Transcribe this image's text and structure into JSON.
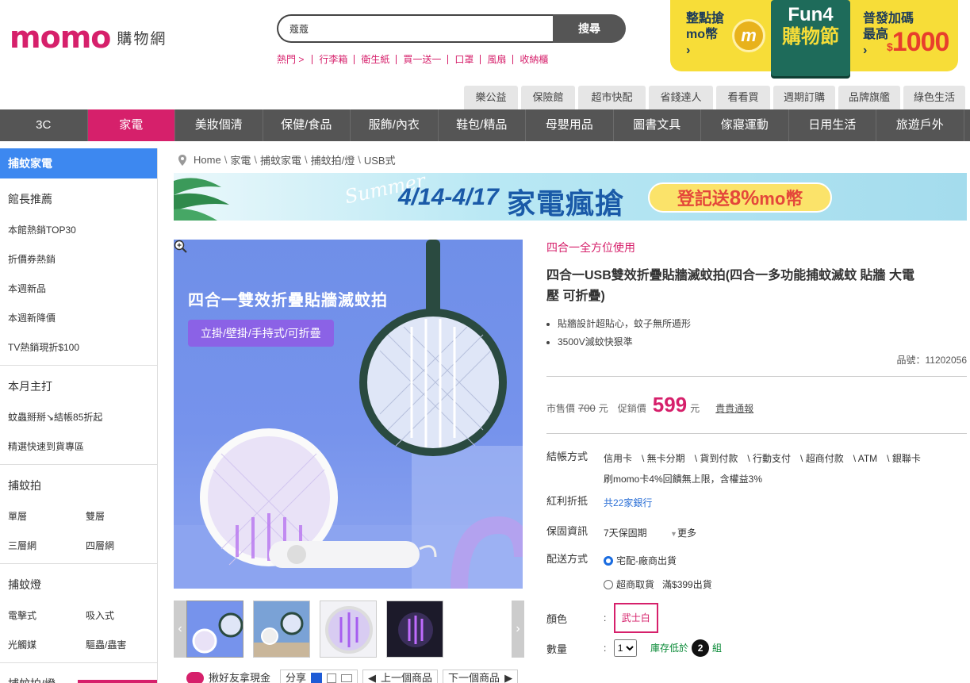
{
  "header": {
    "logo": "momo",
    "logo_sub": "購物網",
    "search_value": "蔻蔻",
    "search_button": "搜尋",
    "hot_label": "熱門 >",
    "hot_keywords": [
      "行李箱",
      "衛生紙",
      "買一送一",
      "口罩",
      "風扇",
      "收納櫃"
    ]
  },
  "promo": {
    "left_line1": "整點搶",
    "left_line2": "mo幣",
    "coin_glyph": "m",
    "fun_line1": "Fun4",
    "fun_line2": "購物節",
    "right_line1": "普發加碼",
    "right_line2": "最高",
    "amount_prefix": "$",
    "amount": "1000"
  },
  "subtabs": [
    "樂公益",
    "保險館",
    "超市快配",
    "省錢達人",
    "看看買",
    "週期訂購",
    "品牌旗艦",
    "綠色生活"
  ],
  "categories": [
    {
      "label": "3C"
    },
    {
      "label": "家電",
      "active": true
    },
    {
      "label": "美妝個清"
    },
    {
      "label": "保健/食品"
    },
    {
      "label": "服飾/內衣"
    },
    {
      "label": "鞋包/精品"
    },
    {
      "label": "母嬰用品"
    },
    {
      "label": "圖書文具"
    },
    {
      "label": "傢寢運動"
    },
    {
      "label": "日用生活"
    },
    {
      "label": "旅遊戶外"
    }
  ],
  "sidebar": {
    "head": "捕蚊家電",
    "groups": [
      {
        "title": "館長推薦",
        "items": [
          "本館熱銷TOP30",
          "折價券熱銷",
          "本週新品",
          "本週新降價",
          "TV熱銷現折$100"
        ],
        "grid": false
      },
      {
        "title": "本月主打",
        "items": [
          "蚊蟲掰掰↘結帳85折起",
          "精選快速到貨專區"
        ],
        "grid": false
      },
      {
        "title": "捕蚊拍",
        "items": [
          "單層",
          "雙層",
          "三層網",
          "四層網"
        ],
        "grid": true
      },
      {
        "title": "捕蚊燈",
        "items": [
          "電擊式",
          "吸入式",
          "光觸媒",
          "驅蟲/蟲害"
        ],
        "grid": true
      },
      {
        "title": "捕蚊拍/燈",
        "items": [],
        "grid": false
      }
    ]
  },
  "breadcrumb": [
    "Home",
    "家電",
    "捕蚊家電",
    "捕蚊拍/燈",
    "USB式"
  ],
  "banner": {
    "summer": "Summer",
    "dates": "4/14-4/17",
    "headline": "家電瘋搶",
    "pill_prefix": "登記送",
    "pill_num": "8%",
    "pill_suffix": "mo幣"
  },
  "main_image": {
    "title": "四合一雙效折疊貼牆滅蚊拍",
    "subtitle": "立掛/壁掛/手持式/可折疊"
  },
  "thumbnails_count": 4,
  "share": {
    "invite": "揪好友拿現金",
    "share_label": "分享",
    "prev": "上一個商品",
    "next": "下一個商品"
  },
  "product": {
    "tagline": "四合一全方位使用",
    "title": "四合一USB雙效折疊貼牆滅蚊拍(四合一多功能捕蚊滅蚊 貼牆 大電壓 可折疊)",
    "features": [
      "貼牆設計超貼心，蚊子無所遁形",
      "3500V滅蚊快狠準"
    ],
    "sku_label": "品號：",
    "sku": "11202056",
    "market_price_label": "市售價",
    "market_price": "700",
    "currency": "元",
    "sale_label": "促銷價",
    "sale_price": "599",
    "notify": "貴貴通報",
    "payment_label": "結帳方式",
    "payments": [
      "信用卡",
      "\\ 無卡分期",
      "\\ 貨到付款",
      "\\ 行動支付",
      "\\ 超商付款",
      "\\ ATM",
      "\\ 銀聯卡"
    ],
    "payment_note": "刷momo卡4%回饋無上限，含權益3%",
    "bonus_label": "紅利折抵",
    "bonus_value": "共22家銀行",
    "warranty_label": "保固資訊",
    "warranty_value": "7天保固期",
    "warranty_more": "更多",
    "shipping_label": "配送方式",
    "shipping_opt1": "宅配-廠商出貨",
    "shipping_opt2": "超商取貨",
    "shipping_opt2_note": "滿$399出貨",
    "color_label": "顏色",
    "color_value": "武士白",
    "qty_label": "數量",
    "qty_value": "1",
    "stock_text_pre": "庫存低於",
    "stock_num": "2",
    "stock_text_post": "組"
  }
}
